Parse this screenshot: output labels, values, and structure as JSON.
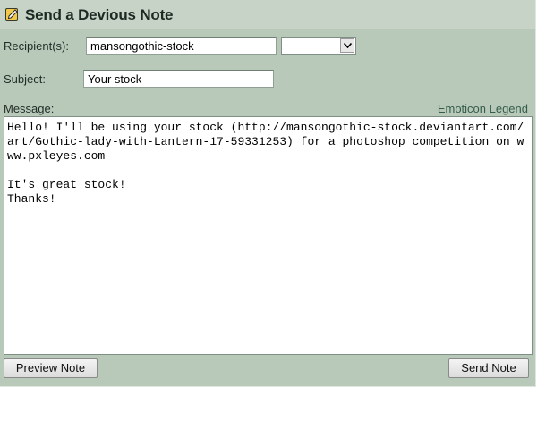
{
  "form": {
    "title": "Send a Devious Note",
    "title_icon": "note-icon",
    "recipient_label": "Recipient(s):",
    "recipient_value": "mansongothic-stock",
    "recipient_select": "-",
    "subject_label": "Subject:",
    "subject_value": "Your stock",
    "message_label": "Message:",
    "emoticon_legend": "Emoticon Legend",
    "message_body": "Hello! I'll be using your stock (http://mansongothic-stock.deviantart.com/art/Gothic-lady-with-Lantern-17-59331253) for a photoshop competition on www.pxleyes.com\n\nIt's great stock!\nThanks!",
    "preview_label": "Preview Note",
    "send_label": "Send Note"
  },
  "colors": {
    "panel_bg": "#b9c9b9",
    "title_bg": "#c6d3c6",
    "link": "#355d4a"
  }
}
